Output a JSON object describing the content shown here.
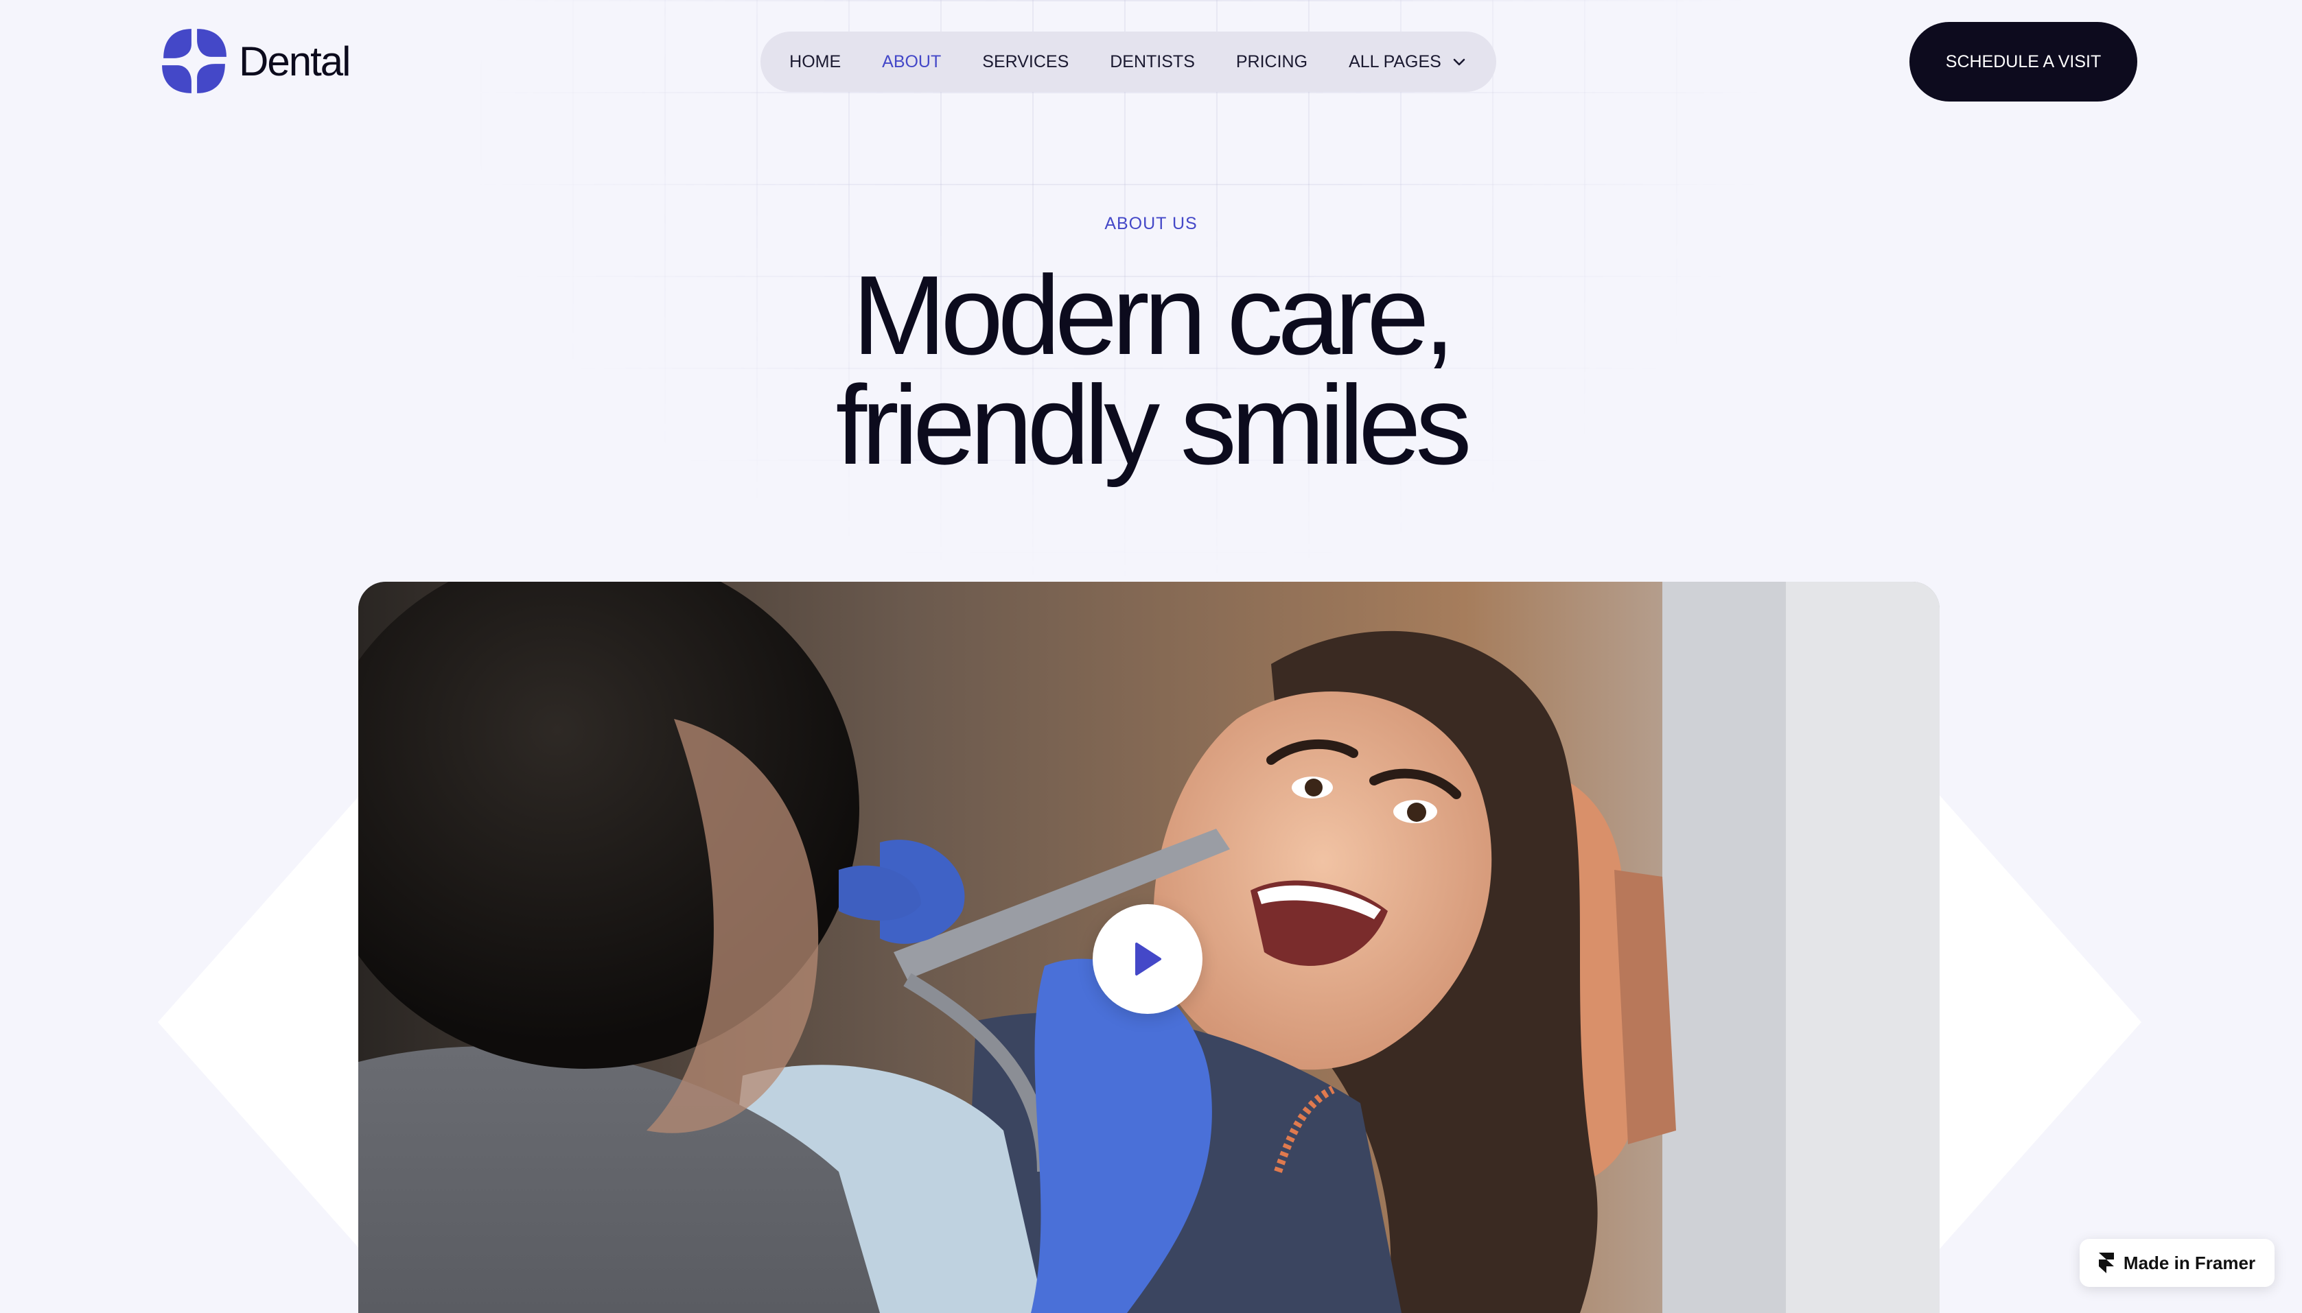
{
  "brand": {
    "name": "Dental",
    "accent_color": "#4448c8",
    "dark_color": "#0d0b1e"
  },
  "nav": {
    "items": [
      {
        "label": "HOME",
        "active": false
      },
      {
        "label": "ABOUT",
        "active": true
      },
      {
        "label": "SERVICES",
        "active": false
      },
      {
        "label": "DENTISTS",
        "active": false
      },
      {
        "label": "PRICING",
        "active": false
      },
      {
        "label": "ALL PAGES",
        "active": false,
        "icon": "chevron-down-icon"
      }
    ]
  },
  "header": {
    "cta_label": "SCHEDULE A VISIT"
  },
  "hero": {
    "eyebrow": "ABOUT US",
    "headline_line1": "Modern care,",
    "headline_line2": "friendly smiles"
  },
  "media": {
    "kind": "photo",
    "play_icon": "play-icon"
  },
  "framer_badge": {
    "label": "Made in Framer",
    "icon": "framer-logo-icon"
  }
}
